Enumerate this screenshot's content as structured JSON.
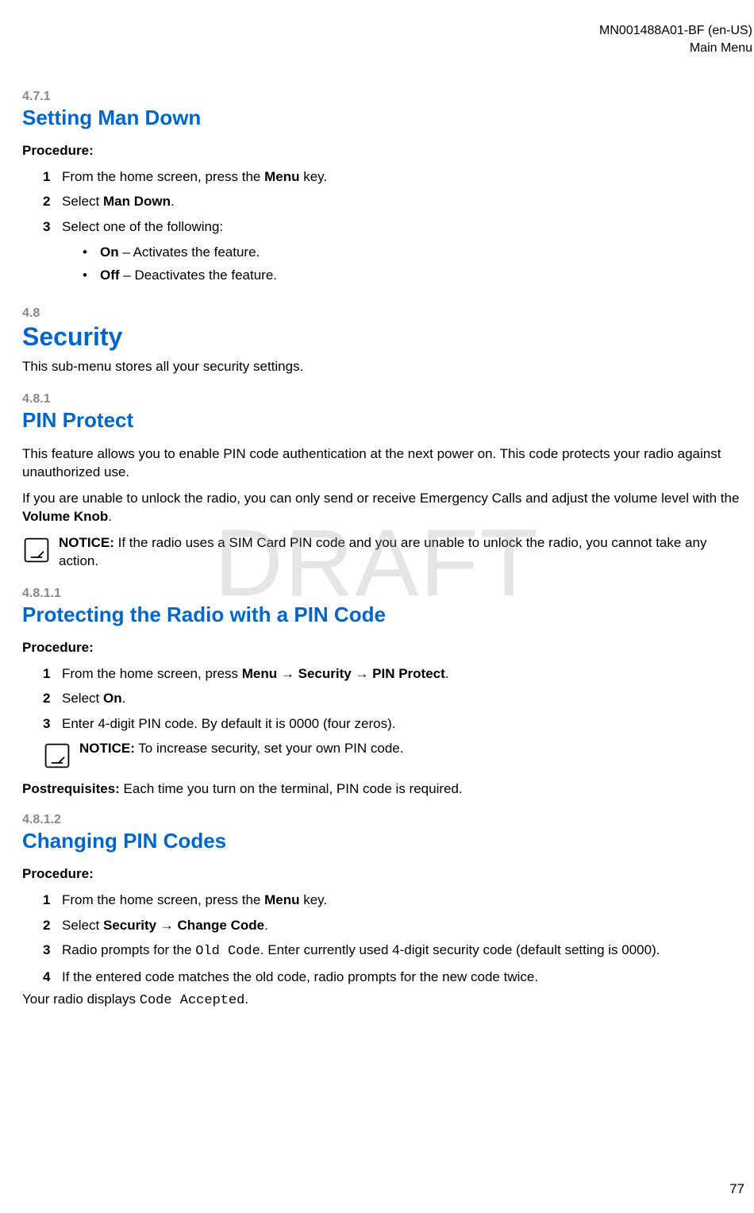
{
  "header": {
    "doc_id": "MN001488A01-BF (en-US)",
    "section": "Main Menu"
  },
  "watermark": "DRAFT",
  "page_number": "77",
  "s471": {
    "num": "4.7.1",
    "title": "Setting Man Down",
    "procedure_label": "Procedure:",
    "step1_a": "From the home screen, press the ",
    "step1_b": "Menu",
    "step1_c": " key.",
    "step2_a": "Select ",
    "step2_b": "Man Down",
    "step2_c": ".",
    "step3": "Select one of the following:",
    "opt_on_b": "On",
    "opt_on_t": " – Activates the feature.",
    "opt_off_b": "Off",
    "opt_off_t": " – Deactivates the feature."
  },
  "s48": {
    "num": "4.8",
    "title": "Security",
    "intro": "This sub-menu stores all your security settings."
  },
  "s481": {
    "num": "4.8.1",
    "title": "PIN Protect",
    "p1": "This feature allows you to enable PIN code authentication at the next power on. This code protects your radio against unauthorized use.",
    "p2_a": "If you are unable to unlock the radio, you can only send or receive Emergency Calls and adjust the volume level with the ",
    "p2_b": "Volume Knob",
    "p2_c": ".",
    "notice_label": "NOTICE:",
    "notice_text": " If the radio uses a SIM Card PIN code and you are unable to unlock the radio, you cannot take any action."
  },
  "s4811": {
    "num": "4.8.1.1",
    "title": "Protecting the Radio with a PIN Code",
    "procedure_label": "Procedure:",
    "step1_a": "From the home screen, press ",
    "step1_b": "Menu",
    "step1_arrow1": " → ",
    "step1_c": "Security",
    "step1_arrow2": " → ",
    "step1_d": "PIN Protect",
    "step1_e": ".",
    "step2_a": "Select ",
    "step2_b": "On",
    "step2_c": ".",
    "step3": "Enter 4-digit PIN code. By default it is 0000 (four zeros).",
    "notice_label": "NOTICE:",
    "notice_text": " To increase security, set your own PIN code.",
    "postreq_label": "Postrequisites:",
    "postreq_text": " Each time you turn on the terminal, PIN code is required."
  },
  "s4812": {
    "num": "4.8.1.2",
    "title": "Changing PIN Codes",
    "procedure_label": "Procedure:",
    "step1_a": "From the home screen, press the ",
    "step1_b": "Menu",
    "step1_c": " key.",
    "step2_a": "Select ",
    "step2_b": "Security",
    "step2_arrow": " → ",
    "step2_c": "Change Code",
    "step2_d": ".",
    "step3_a": "Radio prompts for the ",
    "step3_code": "Old Code",
    "step3_b": ". Enter currently used 4-digit security code (default setting is 0000).",
    "step4": "If the entered code matches the old code, radio prompts for the new code twice.",
    "result_a": "Your radio displays ",
    "result_code": "Code Accepted",
    "result_b": "."
  }
}
